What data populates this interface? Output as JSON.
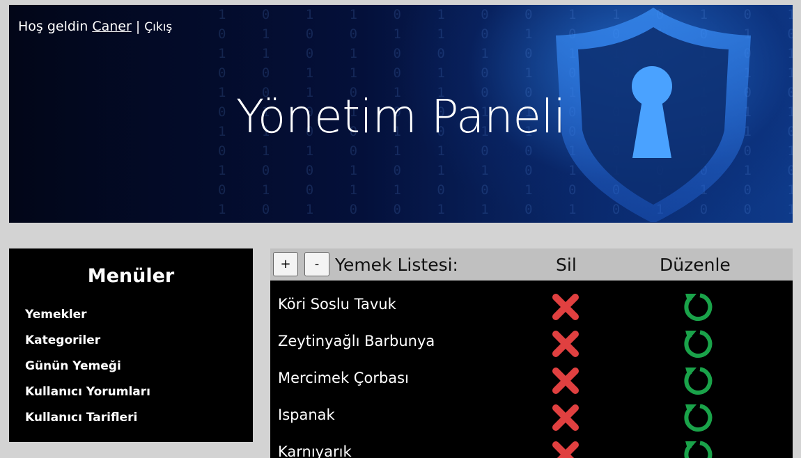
{
  "header": {
    "greeting": "Hoş geldin",
    "username": "Caner",
    "separator": "|",
    "logout": "Çıkış",
    "title": "Yönetim Paneli"
  },
  "menu": {
    "title": "Menüler",
    "items": [
      "Yemekler",
      "Kategoriler",
      "Günün Yemeği",
      "Kullanıcı Yorumları",
      "Kullanıcı Tarifleri"
    ]
  },
  "food_list": {
    "add_label": "+",
    "remove_label": "-",
    "title": "Yemek Listesi:",
    "delete_header": "Sil",
    "edit_header": "Düzenle",
    "items": [
      "Köri Soslu Tavuk",
      "Zeytinyağlı Barbunya",
      "Mercimek Çorbası",
      "Ispanak",
      "Karnıyarık"
    ],
    "delete_icon": "red-x-icon",
    "edit_icon": "green-refresh-icon"
  },
  "colors": {
    "delete_red": "#e04040",
    "edit_green": "#1aa34a",
    "header_grey": "#c0c0c0",
    "banner_blue": "#0e3a8a"
  }
}
